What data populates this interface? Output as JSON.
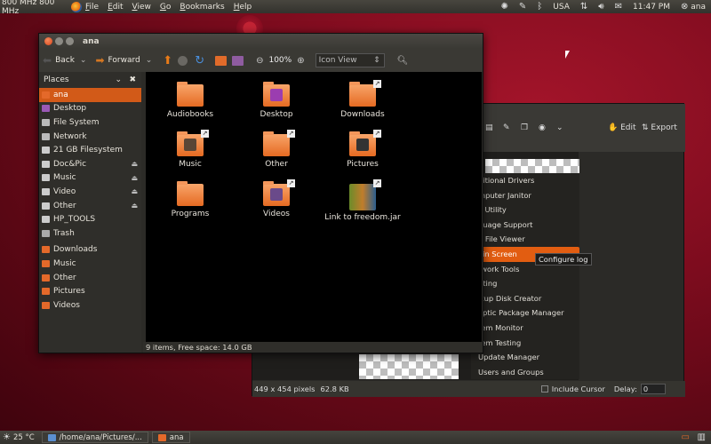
{
  "top_panel": {
    "cpu": "800 MHz 800 MHz",
    "menus": [
      {
        "label": "File",
        "key": "F",
        "rest": "ile"
      },
      {
        "label": "Edit",
        "key": "E",
        "rest": "dit"
      },
      {
        "label": "View",
        "key": "V",
        "rest": "iew"
      },
      {
        "label": "Go",
        "key": "G",
        "rest": "o"
      },
      {
        "label": "Bookmarks",
        "key": "B",
        "rest": "ookmarks"
      },
      {
        "label": "Help",
        "key": "H",
        "rest": "elp"
      }
    ],
    "keyboard_layout": "USA",
    "clock": "11:47 PM",
    "user": "ana"
  },
  "nautilus": {
    "title": "ana",
    "toolbar": {
      "back": "Back",
      "forward": "Forward",
      "zoom": "100%",
      "view_mode": "Icon View"
    },
    "sidebar": {
      "header": "Places",
      "places": [
        {
          "label": "ana",
          "selected": true,
          "color": "#e4692a"
        },
        {
          "label": "Desktop",
          "color": "#9b59b6"
        },
        {
          "label": "File System",
          "color": "#bbbbbb"
        },
        {
          "label": "Network",
          "color": "#bbbbbb"
        },
        {
          "label": "21 GB Filesystem",
          "color": "#cccccc"
        },
        {
          "label": "Doc&Pic",
          "eject": true,
          "color": "#cccccc"
        },
        {
          "label": "Music",
          "eject": true,
          "color": "#cccccc"
        },
        {
          "label": "Video",
          "eject": true,
          "color": "#cccccc"
        },
        {
          "label": "Other",
          "eject": true,
          "color": "#cccccc"
        },
        {
          "label": "HP_TOOLS",
          "color": "#cccccc"
        },
        {
          "label": "Trash",
          "color": "#aaaaaa"
        }
      ],
      "bookmarks": [
        {
          "label": "Downloads",
          "color": "#e4692a"
        },
        {
          "label": "Music",
          "color": "#e4692a"
        },
        {
          "label": "Other",
          "color": "#e4692a"
        },
        {
          "label": "Pictures",
          "color": "#e4692a"
        },
        {
          "label": "Videos",
          "color": "#e4692a"
        }
      ]
    },
    "files": [
      {
        "name": "Audiobooks",
        "type": "folder"
      },
      {
        "name": "Desktop",
        "type": "folder",
        "emblem": "#9b3db0"
      },
      {
        "name": "Downloads",
        "type": "folder",
        "link": true
      },
      {
        "name": "Music",
        "type": "folder",
        "link": true,
        "emblem": "#5a4636"
      },
      {
        "name": "Other",
        "type": "folder",
        "link": true
      },
      {
        "name": "Pictures",
        "type": "folder",
        "link": true,
        "emblem": "#333333"
      },
      {
        "name": "Programs",
        "type": "folder"
      },
      {
        "name": "Videos",
        "type": "folder",
        "link": true,
        "emblem": "#6a4a8a"
      },
      {
        "name": "Link to freedom.jar",
        "type": "jar",
        "link": true
      }
    ],
    "status": "9 items, Free space: 14.0 GB"
  },
  "back_window": {
    "toolbar": {
      "edit": "Edit",
      "export": "Export"
    },
    "menu_items": [
      "ditional Drivers",
      "mputer Janitor",
      "k Utility",
      "guage Support",
      "g File Viewer",
      "ain Screen",
      "twork Tools",
      "nting",
      "rtup Disk Creator",
      "aptic Package Manager",
      "tem Monitor",
      "tem Testing",
      "Update Manager",
      "Users and Groups"
    ],
    "selected_index": 5,
    "tooltip": "Configure log",
    "status": {
      "dimensions": "449 x 454 pixels",
      "size": "62.8 KB",
      "include_cursor": "Include Cursor",
      "delay_label": "Delay:",
      "delay_value": "0"
    }
  },
  "bottom_panel": {
    "temp": "25 °C",
    "tasks": [
      "/home/ana/Pictures/...",
      "ana"
    ]
  }
}
